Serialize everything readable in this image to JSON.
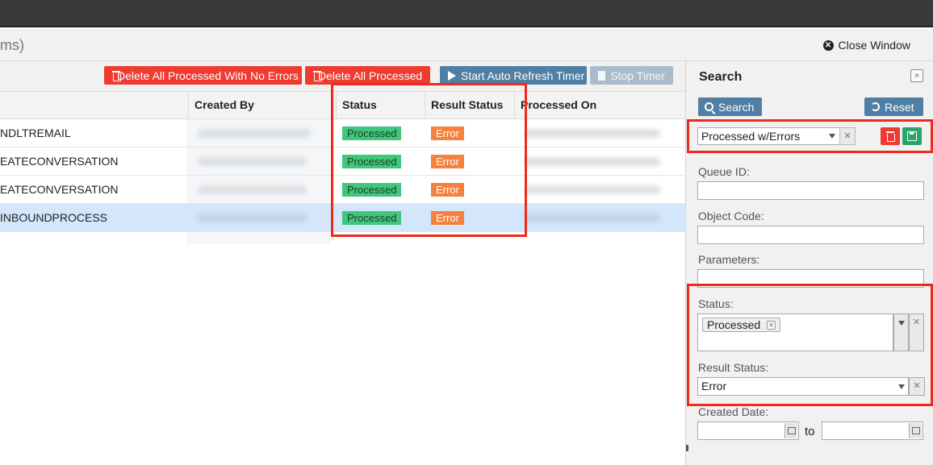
{
  "window": {
    "title_partial": "ms)",
    "close_label": "Close Window"
  },
  "toolbar": {
    "delete_no_errors": "Delete All Processed With No Errors",
    "delete_all_processed": "Delete All Processed",
    "start_timer": "Start Auto Refresh Timer",
    "stop_timer": "Stop Timer"
  },
  "grid": {
    "columns": [
      "Created By",
      "Status",
      "Result Status",
      "Processed On"
    ],
    "rows": [
      {
        "object_code": "NDLTREMAIL",
        "status": "Processed",
        "result_status": "Error",
        "selected": false
      },
      {
        "object_code": "EATECONVERSATION",
        "status": "Processed",
        "result_status": "Error",
        "selected": false
      },
      {
        "object_code": "EATECONVERSATION",
        "status": "Processed",
        "result_status": "Error",
        "selected": false
      },
      {
        "object_code": "INBOUNDPROCESS",
        "status": "Processed",
        "result_status": "Error",
        "selected": true
      }
    ]
  },
  "search_panel": {
    "title": "Search",
    "search_label": "Search",
    "reset_label": "Reset",
    "saved_search": "Processed w/Errors",
    "fields": {
      "queue_id": "Queue ID:",
      "object_code": "Object Code:",
      "parameters": "Parameters:",
      "status": "Status:",
      "result_status": "Result Status:",
      "created_date": "Created Date:"
    },
    "status_chip": "Processed",
    "result_status_value": "Error",
    "to_label": "to"
  },
  "colors": {
    "highlight": "#ee2a1a",
    "delete_red": "#ef3b30",
    "toolbar_blue": "#4f7fa4",
    "processed_green": "#3fc77b",
    "error_orange": "#f5813e",
    "selected_row": "#d4e6fb"
  }
}
